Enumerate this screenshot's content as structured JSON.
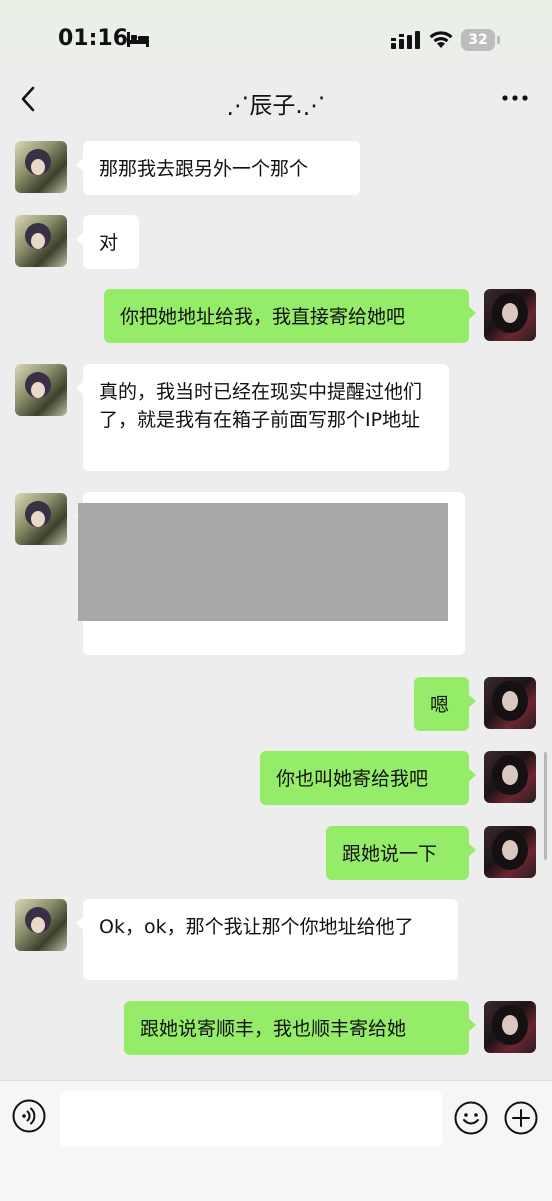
{
  "status_bar": {
    "time": "01:16",
    "battery_level": "32",
    "icons": [
      "bed-icon",
      "signal-icon",
      "wifi-icon",
      "battery-icon"
    ]
  },
  "nav": {
    "title": "⋰辰子.⋰",
    "back_icon": "chevron-left-icon",
    "more_icon": "more-icon"
  },
  "messages": [
    {
      "side": "in",
      "text": "那那我去跟另外一个那个"
    },
    {
      "side": "in",
      "text": "对"
    },
    {
      "side": "out",
      "text": "你把她地址给我，我直接寄给她吧"
    },
    {
      "side": "in",
      "text": "真的，我当时已经在现实中提醒过他们了，就是我有在箱子前面写那个IP地址"
    },
    {
      "side": "in",
      "type": "redacted",
      "text": ""
    },
    {
      "side": "out",
      "text": "嗯"
    },
    {
      "side": "out",
      "text": "你也叫她寄给我吧"
    },
    {
      "side": "out",
      "text": "跟她说一下"
    },
    {
      "side": "in",
      "text": "Ok，ok，那个我让那个你地址给他了"
    },
    {
      "side": "out",
      "text": "跟她说寄顺丰，我也顺丰寄给她"
    }
  ],
  "input_bar": {
    "text_value": "",
    "icons": [
      "voice-icon",
      "mic-icon",
      "emoji-icon",
      "plus-icon"
    ]
  },
  "colors": {
    "background": "#ededed",
    "bubble_in": "#ffffff",
    "bubble_out": "#95ec69"
  }
}
